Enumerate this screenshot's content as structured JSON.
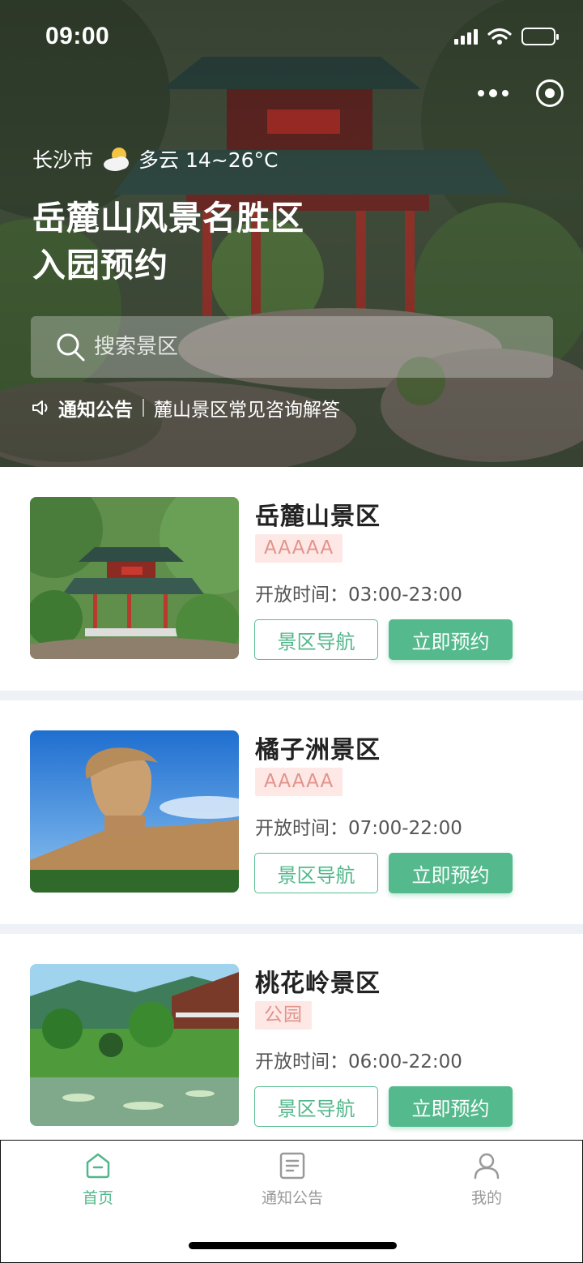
{
  "status_bar": {
    "time": "09:00"
  },
  "hero": {
    "city": "长沙市",
    "weather": "多云 14~26°C",
    "title_line1": "岳麓山风景名胜区",
    "title_line2": "入园预约",
    "search_placeholder": "搜索景区",
    "notice_label": "通知公告",
    "notice_text": "麓山景区常见咨询解答"
  },
  "scenic_spots": [
    {
      "name": "岳麓山景区",
      "badge": "AAAAA",
      "hours": "开放时间：03:00-23:00",
      "nav_label": "景区导航",
      "book_label": "立即预约"
    },
    {
      "name": "橘子洲景区",
      "badge": "AAAAA",
      "hours": "开放时间：07:00-22:00",
      "nav_label": "景区导航",
      "book_label": "立即预约"
    },
    {
      "name": "桃花岭景区",
      "badge": "公园",
      "hours": "开放时间：06:00-22:00",
      "nav_label": "景区导航",
      "book_label": "立即预约"
    }
  ],
  "tabbar": {
    "items": [
      {
        "label": "首页",
        "icon": "home-icon",
        "active": true
      },
      {
        "label": "通知公告",
        "icon": "notice-doc-icon",
        "active": false
      },
      {
        "label": "我的",
        "icon": "user-icon",
        "active": false
      }
    ]
  },
  "colors": {
    "accent": "#54b98c",
    "badge_bg": "#fde8e6",
    "badge_text": "#e2938b",
    "divider": "#eef2f7"
  }
}
